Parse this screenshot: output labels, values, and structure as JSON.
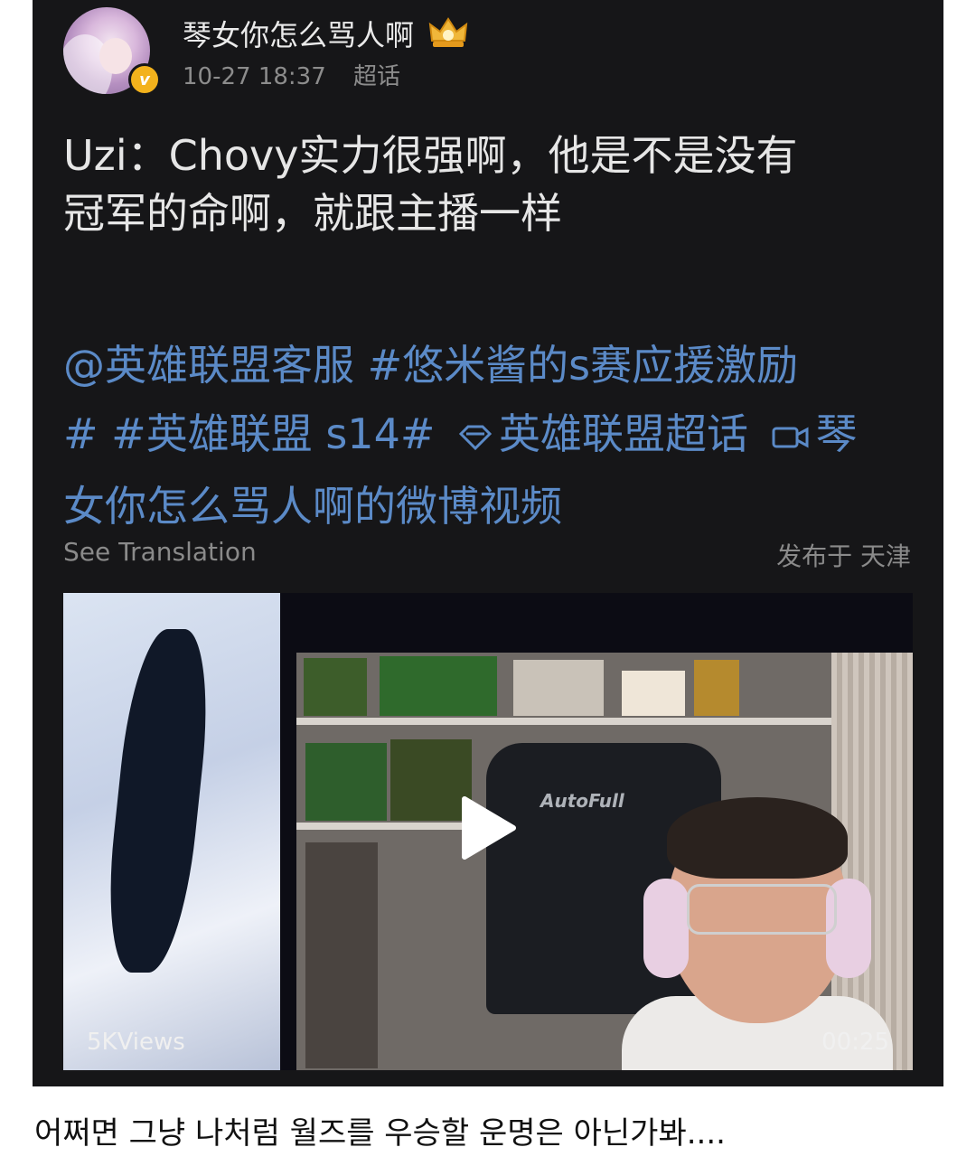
{
  "post": {
    "username": "琴女你怎么骂人啊",
    "timestamp": "10-27 18:37",
    "source_tag": "超话",
    "content_line1": "Uzi：Chovy实力很强啊，他是不是没有",
    "content_line2": "冠军的命啊，就跟主播一样",
    "mention": "@英雄联盟客服",
    "hashtag1": "#悠米酱的s赛应援激励",
    "hashtag2": "# #英雄联盟 s14#",
    "supertopic": "英雄联盟超话",
    "video_link_part1": "琴",
    "video_link_part2": "女你怎么骂人啊的微博视频",
    "see_translation": "See Translation",
    "location": "发布于 天津",
    "video": {
      "chair_brand": "AutoFull",
      "views": "5KViews",
      "duration": "00:25"
    }
  },
  "caption": "어쩌면 그냥 나처럼 월즈를 우승할 운명은 아닌가봐....",
  "icons": {
    "crown": "crown-badge-icon",
    "verified": "verified-badge-icon",
    "supertopic": "diamond-icon",
    "video": "video-camera-icon",
    "play": "play-icon"
  },
  "colors": {
    "post_bg": "#161618",
    "link": "#5b8ac7",
    "text": "#e6e6e6",
    "muted": "#8a8a8a",
    "verified": "#f3b21c"
  }
}
